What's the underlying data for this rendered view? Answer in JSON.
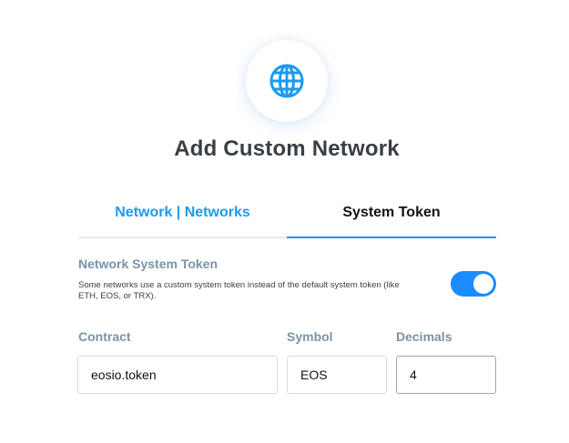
{
  "header": {
    "icon": "globe-icon",
    "title": "Add Custom Network"
  },
  "tabs": [
    {
      "label": "Network | Networks",
      "active": false
    },
    {
      "label": "System Token",
      "active": true
    }
  ],
  "system_token": {
    "title": "Network System Token",
    "description": "Some networks use a custom system token instead of the default system token (like ETH, EOS, or TRX).",
    "toggle_on": true
  },
  "fields": {
    "contract": {
      "label": "Contract",
      "value": "eosio.token"
    },
    "symbol": {
      "label": "Symbol",
      "value": "EOS"
    },
    "decimals": {
      "label": "Decimals",
      "value": "4"
    }
  },
  "colors": {
    "accent": "#1a9bf0",
    "label": "#7a93a8",
    "title": "#3a3f44"
  }
}
